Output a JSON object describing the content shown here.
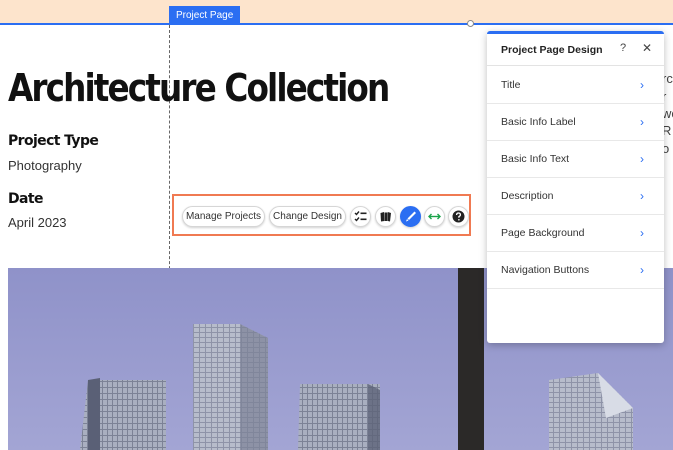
{
  "editor": {
    "page_tag": "Project Page"
  },
  "page": {
    "title": "Architecture Collection",
    "fields": [
      {
        "label": "Project Type",
        "value": "Photography"
      },
      {
        "label": "Date",
        "value": "April 2023"
      }
    ],
    "right_text_fragments": [
      "rcl",
      "r",
      "wo",
      "R",
      "o"
    ]
  },
  "toolbar": {
    "manage_label": "Manage Projects",
    "design_label": "Change Design",
    "icons": [
      "checklist-icon",
      "layouts-icon",
      "brush-icon",
      "stretch-icon",
      "help-icon"
    ]
  },
  "panel": {
    "title": "Project Page Design",
    "help": "?",
    "close": "✕",
    "items": [
      {
        "label": "Title"
      },
      {
        "label": "Basic Info Label"
      },
      {
        "label": "Basic Info Text"
      },
      {
        "label": "Description"
      },
      {
        "label": "Page Background"
      },
      {
        "label": "Navigation Buttons"
      }
    ],
    "chevron": "›"
  },
  "colors": {
    "accent": "#2b6ef2",
    "selection_border": "#f07a52",
    "header_band": "#fde4cc",
    "sky": "#9496cc"
  }
}
